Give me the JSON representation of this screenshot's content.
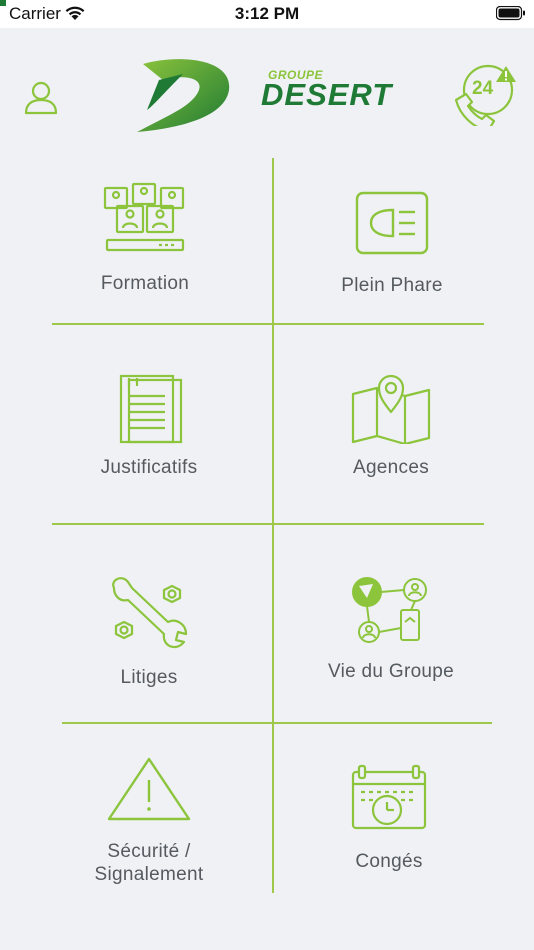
{
  "colors": {
    "accent": "#8cc43c",
    "line": "#9dc84a",
    "logo_dark": "#1e7a34",
    "logo_light": "#8cc43c",
    "label": "#555a60",
    "background": "#eff1f4"
  },
  "status_bar": {
    "carrier": "Carrier",
    "time": "3:12 PM",
    "icons": [
      "wifi-icon",
      "battery-icon"
    ]
  },
  "header": {
    "profile_icon": "user-icon",
    "logo": {
      "groupe": "GROUPE",
      "desert": "DESERT"
    },
    "support_icon": "phone-24-alert-icon",
    "support_badge": "24"
  },
  "menu": {
    "items": [
      {
        "label": "Formation",
        "icon": "training-icon"
      },
      {
        "label": "Plein Phare",
        "icon": "headlight-icon"
      },
      {
        "label": "Justificatifs",
        "icon": "documents-icon"
      },
      {
        "label": "Agences",
        "icon": "map-pin-icon"
      },
      {
        "label": "Litiges",
        "icon": "tools-icon"
      },
      {
        "label": "Vie du Groupe",
        "icon": "network-icon"
      },
      {
        "label": "Sécurité /",
        "label2": "Signalement",
        "icon": "warning-icon"
      },
      {
        "label": "Congés",
        "icon": "calendar-clock-icon"
      }
    ]
  }
}
